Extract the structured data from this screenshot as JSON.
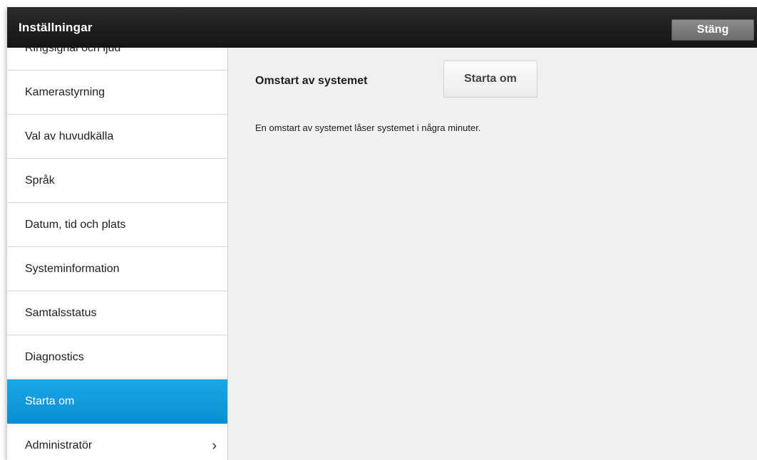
{
  "header": {
    "title": "Inställningar",
    "close_label": "Stäng"
  },
  "sidebar": {
    "items": [
      {
        "label": "Ringsignal och ljud"
      },
      {
        "label": "Kamerastyrning"
      },
      {
        "label": "Val av huvudkälla"
      },
      {
        "label": "Språk"
      },
      {
        "label": "Datum, tid och plats"
      },
      {
        "label": "Systeminformation"
      },
      {
        "label": "Samtalsstatus"
      },
      {
        "label": "Diagnostics"
      },
      {
        "label": "Starta om",
        "selected": true
      },
      {
        "label": "Administratör",
        "icon": "chevron-right-icon"
      }
    ]
  },
  "main": {
    "row_label": "Omstart av systemet",
    "button_label": "Starta om",
    "description": "En omstart av systemet låser systemet i några minuter."
  },
  "colors": {
    "accent": "#0a9ae0",
    "titlebar": "#1c1c1c"
  }
}
